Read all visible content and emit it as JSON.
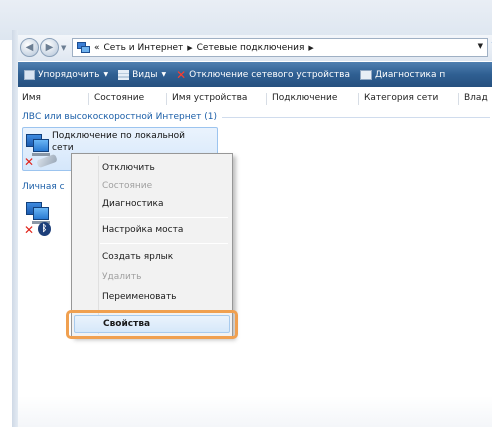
{
  "address": {
    "prefix": "«",
    "crumbs": [
      "Сеть и Интернет",
      "Сетевые подключения"
    ]
  },
  "toolbar": {
    "organize": "Упорядочить",
    "views": "Виды",
    "disconnect": "Отключение сетевого устройства",
    "diagnostics": "Диагностика п"
  },
  "columns": [
    "Имя",
    "Состояние",
    "Имя устройства",
    "Подключение",
    "Категория сети",
    "Влад"
  ],
  "group": {
    "title": "ЛВС или высокоскоростной Интернет (1)"
  },
  "selected_item": {
    "name_line1": "Подключение по локальной",
    "name_line2": "сети"
  },
  "group2_label": "Личная с",
  "context_menu": {
    "items": [
      {
        "label": "Отключить",
        "enabled": true
      },
      {
        "label": "Состояние",
        "enabled": false
      },
      {
        "label": "Диагностика",
        "enabled": true
      },
      {
        "label": "Настройка моста",
        "enabled": true
      },
      {
        "label": "Создать ярлык",
        "enabled": true
      },
      {
        "label": "Удалить",
        "enabled": false
      },
      {
        "label": "Переименовать",
        "enabled": true
      },
      {
        "label": "Свойства",
        "enabled": true,
        "default": true
      }
    ]
  },
  "colors": {
    "toolbar": "#2f5f92",
    "group_title": "#1c5fa8",
    "highlight": "#f0a050",
    "disconnect_icon": "#ff3c2a"
  }
}
